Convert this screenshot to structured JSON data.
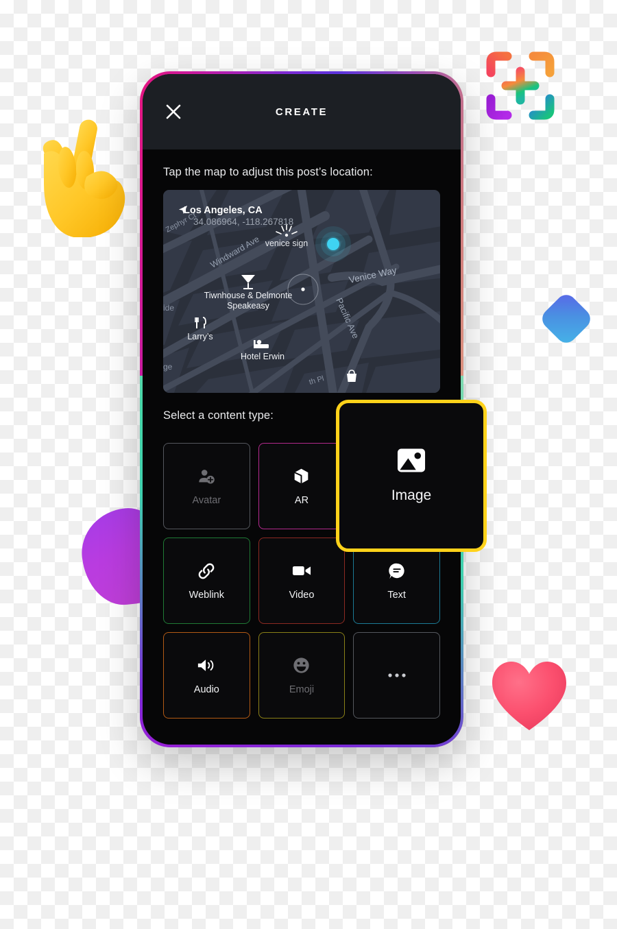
{
  "header": {
    "title": "CREATE",
    "close_icon": "close-icon"
  },
  "map_section": {
    "prompt": "Tap the map to adjust this post’s location:",
    "place_name": "Los Angeles, CA",
    "coordinates": "34.086964, -118.267818",
    "navigation_icon": "navigation-arrow-icon",
    "marker_color": "#3fd3f2",
    "streets": [
      "Zephyr Ct",
      "Windward Ave",
      "Venice Way",
      "Pacific Ave",
      "th Pl"
    ],
    "pois": [
      {
        "label": "venice sign",
        "icon": "landmark-icon"
      },
      {
        "label": "Tiwnhouse & Delmonte Speakeasy",
        "icon": "cocktail-icon"
      },
      {
        "label": "Larry’s",
        "icon": "restaurant-icon"
      },
      {
        "label": "Hotel Erwin",
        "icon": "hotel-bed-icon"
      },
      {
        "label": "",
        "icon": "shopping-bag-icon"
      }
    ],
    "edge_labels": [
      "ide",
      "ge"
    ]
  },
  "content_section": {
    "prompt": "Select a content type:",
    "tiles": [
      {
        "label": "Avatar",
        "icon": "add-person-icon",
        "border": "#55585e",
        "enabled": false
      },
      {
        "label": "AR",
        "icon": "cube-3d-icon",
        "border": "#b32a8e",
        "enabled": true
      },
      {
        "label": "Image",
        "icon": "image-icon",
        "border": "#2c9c9c",
        "enabled": true
      },
      {
        "label": "Weblink",
        "icon": "link-icon",
        "border": "#1f7a35",
        "enabled": true
      },
      {
        "label": "Video",
        "icon": "video-camera-icon",
        "border": "#8c2a22",
        "enabled": true
      },
      {
        "label": "Text",
        "icon": "speech-bubble-icon",
        "border": "#1b7b96",
        "enabled": true
      },
      {
        "label": "Audio",
        "icon": "speaker-icon",
        "border": "#b35a14",
        "enabled": true
      },
      {
        "label": "Emoji",
        "icon": "smiley-icon",
        "border": "#8a8018",
        "enabled": false
      },
      {
        "label": "",
        "icon": "more-dots-icon",
        "border": "#55585e",
        "enabled": true
      }
    ]
  },
  "highlight": {
    "label": "Image",
    "icon": "image-icon",
    "border_color": "#ffd21a"
  },
  "decorations": [
    {
      "name": "capture-plus-icon",
      "colors": [
        "#f4455c",
        "#f58b3c",
        "#a020f0",
        "#19c37d"
      ]
    },
    {
      "name": "rock-on-hand-emoji",
      "color": "#ffc727"
    },
    {
      "name": "blue-diamond-shape",
      "color": "#4a90e2"
    },
    {
      "name": "purple-blob-shape",
      "color": "#b93ce0"
    },
    {
      "name": "heart-emoji",
      "color": "#fb4f6e"
    }
  ],
  "phone_frame": {
    "gradient_stops": [
      "#e6157f",
      "#7b2bd6",
      "#f0b98a",
      "#3ecfae"
    ]
  }
}
